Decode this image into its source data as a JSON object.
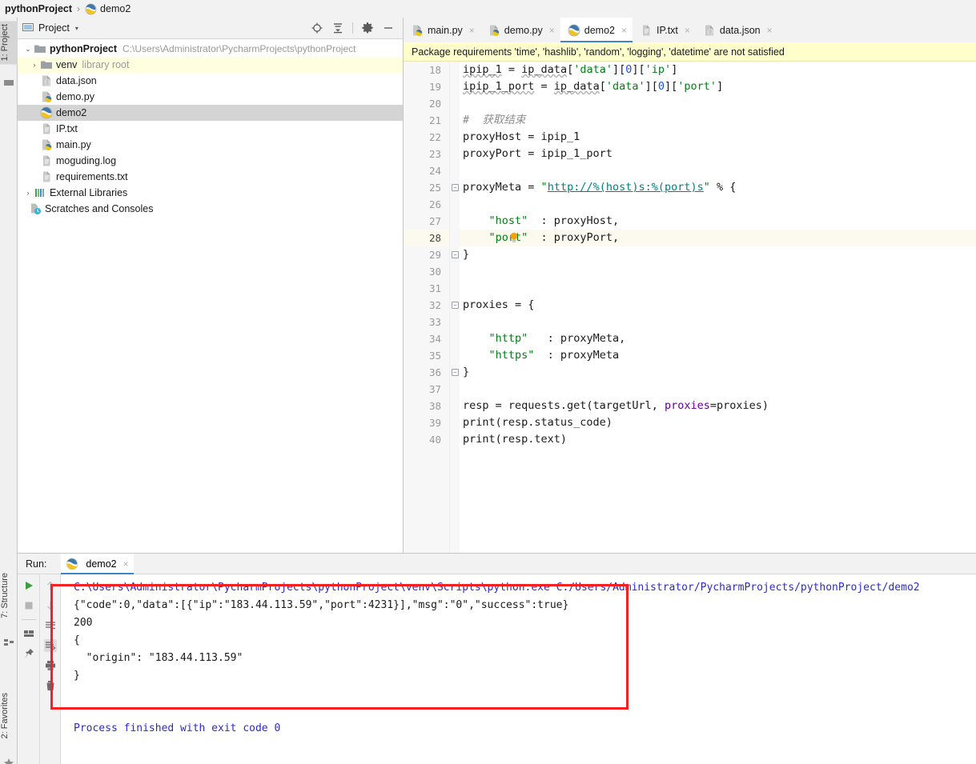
{
  "breadcrumb": {
    "project": "pythonProject",
    "separator": "›",
    "file": "demo2"
  },
  "left_strip": {
    "tabs": [
      {
        "label": "1: Project",
        "active": true
      },
      {
        "label": "7: Structure",
        "active": false
      },
      {
        "label": "2: Favorites",
        "active": false
      }
    ]
  },
  "project_panel": {
    "title": "Project",
    "caret": "▾",
    "tools": [
      "locate-icon",
      "collapse-all-icon",
      "gear-icon",
      "minimize-icon"
    ],
    "tree": [
      {
        "label": "pythonProject",
        "path": "C:\\Users\\Administrator\\PycharmProjects\\pythonProject",
        "icon": "folder-icon",
        "arrow": "⌄",
        "bold": true,
        "indent": 0,
        "state": ""
      },
      {
        "label": "venv",
        "sub": "library root",
        "icon": "folder-icon",
        "arrow": "›",
        "bold": false,
        "indent": 1,
        "state": "warn"
      },
      {
        "label": "data.json",
        "icon": "json-icon",
        "arrow": "",
        "bold": false,
        "indent": 2,
        "state": ""
      },
      {
        "label": "demo.py",
        "icon": "python-icon",
        "arrow": "",
        "bold": false,
        "indent": 2,
        "state": ""
      },
      {
        "label": "demo2",
        "icon": "python-plain-icon",
        "arrow": "",
        "bold": false,
        "indent": 2,
        "state": "sel"
      },
      {
        "label": "IP.txt",
        "icon": "text-icon",
        "arrow": "",
        "bold": false,
        "indent": 2,
        "state": ""
      },
      {
        "label": "main.py",
        "icon": "python-icon",
        "arrow": "",
        "bold": false,
        "indent": 2,
        "state": ""
      },
      {
        "label": "moguding.log",
        "icon": "text-icon",
        "arrow": "",
        "bold": false,
        "indent": 2,
        "state": ""
      },
      {
        "label": "requirements.txt",
        "icon": "text-icon",
        "arrow": "",
        "bold": false,
        "indent": 2,
        "state": ""
      },
      {
        "label": "External Libraries",
        "icon": "library-icon",
        "arrow": "›",
        "bold": false,
        "indent": 0,
        "state": ""
      },
      {
        "label": "Scratches and Consoles",
        "icon": "scratches-icon",
        "arrow": "",
        "bold": false,
        "indent": 1,
        "state": ""
      }
    ]
  },
  "editor": {
    "tabs": [
      {
        "label": "main.py",
        "icon": "python-icon",
        "active": false
      },
      {
        "label": "demo.py",
        "icon": "python-icon",
        "active": false
      },
      {
        "label": "demo2",
        "icon": "python-plain-icon",
        "active": true
      },
      {
        "label": "IP.txt",
        "icon": "text-icon",
        "active": false
      },
      {
        "label": "data.json",
        "icon": "json-icon",
        "active": false
      }
    ],
    "close_glyph": "×",
    "warning_banner": "Package requirements 'time', 'hashlib', 'random', 'logging', 'datetime' are not satisfied",
    "first_line_number": 18,
    "current_line": 28,
    "lines": [
      {
        "n": 18,
        "text": "ipip_1 = ip_data['data'][0]['ip']"
      },
      {
        "n": 19,
        "text": "ipip_1_port = ip_data['data'][0]['port']"
      },
      {
        "n": 20,
        "text": ""
      },
      {
        "n": 21,
        "text": "#  获取结束"
      },
      {
        "n": 22,
        "text": "proxyHost = ipip_1"
      },
      {
        "n": 23,
        "text": "proxyPort = ipip_1_port"
      },
      {
        "n": 24,
        "text": ""
      },
      {
        "n": 25,
        "text": "proxyMeta = \"http://%(host)s:%(port)s\" % {"
      },
      {
        "n": 26,
        "text": ""
      },
      {
        "n": 27,
        "text": "    \"host\"  : proxyHost,"
      },
      {
        "n": 28,
        "text": "    \"port\"  : proxyPort,"
      },
      {
        "n": 29,
        "text": "}"
      },
      {
        "n": 30,
        "text": ""
      },
      {
        "n": 31,
        "text": ""
      },
      {
        "n": 32,
        "text": "proxies = {"
      },
      {
        "n": 33,
        "text": ""
      },
      {
        "n": 34,
        "text": "    \"http\"   : proxyMeta,"
      },
      {
        "n": 35,
        "text": "    \"https\"  : proxyMeta"
      },
      {
        "n": 36,
        "text": "}"
      },
      {
        "n": 37,
        "text": ""
      },
      {
        "n": 38,
        "text": "resp = requests.get(targetUrl, proxies=proxies)"
      },
      {
        "n": 39,
        "text": "print(resp.status_code)"
      },
      {
        "n": 40,
        "text": "print(resp.text)"
      }
    ]
  },
  "run_panel": {
    "label": "Run:",
    "tab": {
      "label": "demo2",
      "icon": "python-plain-icon"
    },
    "close_glyph": "×",
    "left_tools": [
      "run-icon",
      "stop-icon",
      "layout-icon",
      "pin-icon"
    ],
    "right_tools": [
      "scroll-up-icon",
      "scroll-down-icon",
      "soft-wrap-icon",
      "scroll-to-end-icon",
      "print-icon",
      "trash-icon"
    ],
    "console": [
      {
        "text": "C:\\Users\\Administrator\\PycharmProjects\\pythonProject\\venv\\Scripts\\python.exe C:/Users/Administrator/PycharmProjects/pythonProject/demo2",
        "kind": "cmd"
      },
      {
        "text": "{\"code\":0,\"data\":[{\"ip\":\"183.44.113.59\",\"port\":4231}],\"msg\":\"0\",\"success\":true}",
        "kind": "out"
      },
      {
        "text": "200",
        "kind": "out"
      },
      {
        "text": "{",
        "kind": "out"
      },
      {
        "text": "  \"origin\": \"183.44.113.59\"",
        "kind": "out"
      },
      {
        "text": "}",
        "kind": "out"
      },
      {
        "text": "",
        "kind": "out"
      },
      {
        "text": "",
        "kind": "out"
      },
      {
        "text": "Process finished with exit code 0",
        "kind": "fin"
      }
    ]
  },
  "annotation": {
    "shape": "rectangle",
    "color": "#f52020"
  }
}
